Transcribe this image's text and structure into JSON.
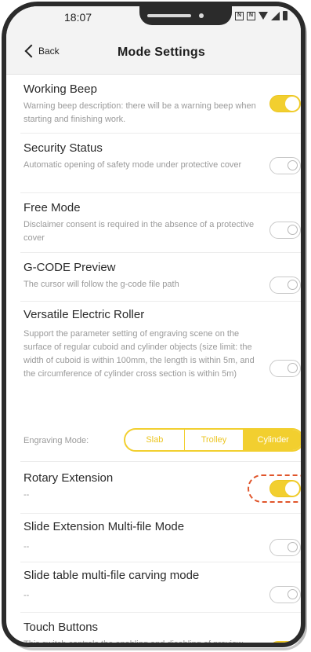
{
  "status_bar": {
    "time": "18:07",
    "icons": [
      "nfc-icon",
      "nfc-alt-icon",
      "wifi-icon",
      "signal-icon",
      "battery-icon"
    ]
  },
  "nav": {
    "back_label": "Back",
    "title": "Mode Settings"
  },
  "settings": [
    {
      "title": "Working Beep",
      "description": "Warning beep description: there will be a warning beep when starting and finishing work.",
      "enabled": true
    },
    {
      "title": "Security Status",
      "description": "Automatic opening of safety mode under protective cover",
      "enabled": false
    },
    {
      "title": "Free Mode",
      "description": "Disclaimer consent is required in the absence of a protective cover",
      "enabled": false
    },
    {
      "title": "G-CODE Preview",
      "description": "The cursor will follow the g-code file path",
      "enabled": false
    },
    {
      "title": "Versatile Electric Roller",
      "description": "Support the parameter setting of engraving scene on the surface of regular cuboid and cylinder objects (size limit: the width of cuboid is within 100mm, the length is within 5m, and the circumference of cylinder cross section is within 5m)",
      "enabled": false
    },
    {
      "title": "Rotary Extension",
      "description": "--",
      "enabled": true
    },
    {
      "title": "Slide Extension Multi-file Mode",
      "description": "--",
      "enabled": false
    },
    {
      "title": "Slide table multi-file carving mode",
      "description": "--",
      "enabled": false
    },
    {
      "title": "Touch Buttons",
      "description": "This switch controls the enabling and disabling of preview and stop touch buttons on the main",
      "enabled": true
    }
  ],
  "engraving_mode": {
    "label": "Engraving Mode:",
    "options": [
      "Slab",
      "Trolley",
      "Cylinder"
    ],
    "selected": "Cylinder"
  },
  "colors": {
    "accent": "#f2cf2f",
    "highlight": "#e0552b"
  }
}
